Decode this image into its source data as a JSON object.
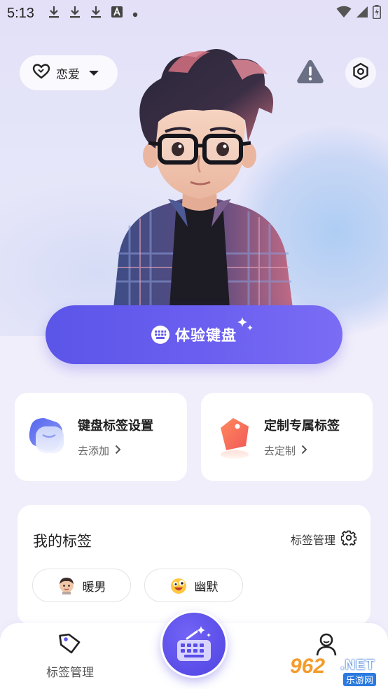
{
  "status_bar": {
    "time": "5:13",
    "icons": [
      "download-icon",
      "download-icon",
      "download-icon",
      "font-icon",
      "dot-icon"
    ],
    "right_icons": [
      "wifi-icon",
      "signal-icon",
      "battery-charging-icon"
    ]
  },
  "header": {
    "mode_label": "恋爱",
    "mode_icon": "heart-outline-icon",
    "warn_icon": "warning-icon",
    "settings_icon": "hexagon-settings-icon"
  },
  "cta": {
    "label": "体验键盘",
    "icon": "keyboard-icon",
    "accent": "#5f57ea"
  },
  "cards": [
    {
      "title": "键盘标签设置",
      "link": "去添加",
      "icon": "tag-stack-icon"
    },
    {
      "title": "定制专属标签",
      "link": "去定制",
      "icon": "custom-tag-icon"
    }
  ],
  "my_tags": {
    "title": "我的标签",
    "manage_label": "标签管理",
    "manage_icon": "gear-icon",
    "tags": [
      {
        "label": "暖男",
        "icon": "boy-emoji-icon"
      },
      {
        "label": "幽默",
        "icon": "laughing-emoji-icon"
      }
    ]
  },
  "bottom_nav": {
    "items": [
      {
        "label": "标签管理",
        "icon": "tag-icon"
      },
      {
        "label": "",
        "icon": "keyboard-magic-icon"
      },
      {
        "label": "",
        "icon": "profile-icon"
      }
    ]
  },
  "watermark": {
    "number": "962",
    "suffix": ".NET",
    "site": "乐游网"
  }
}
